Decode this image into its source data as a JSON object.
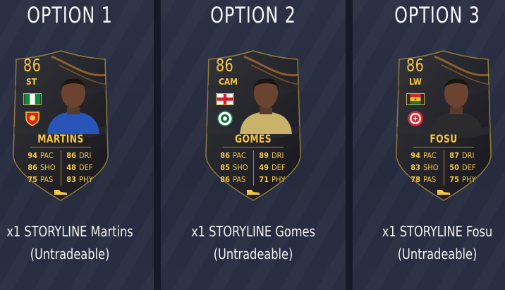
{
  "options": [
    {
      "title": "OPTION 1",
      "card": {
        "rating": "86",
        "position": "ST",
        "name": "MARTINS",
        "stats": [
          [
            "94",
            "PAC"
          ],
          [
            "86",
            "DRI"
          ],
          [
            "86",
            "SHO"
          ],
          [
            "48",
            "DEF"
          ],
          [
            "75",
            "PAS"
          ],
          [
            "83",
            "PHY"
          ]
        ],
        "flag": "nigeria-flag-icon",
        "club": "club-crest-icon",
        "kit_color": "#2a55b8"
      },
      "reward_line1": "x1 STORYLINE Martins",
      "reward_line2": "(Untradeable)"
    },
    {
      "title": "OPTION 2",
      "card": {
        "rating": "86",
        "position": "CAM",
        "name": "GOMES",
        "stats": [
          [
            "86",
            "PAC"
          ],
          [
            "89",
            "DRI"
          ],
          [
            "85",
            "SHO"
          ],
          [
            "49",
            "DEF"
          ],
          [
            "86",
            "PAS"
          ],
          [
            "71",
            "PHY"
          ]
        ],
        "flag": "england-flag-icon",
        "club": "club-crest-icon",
        "kit_color": "#c9b26a"
      },
      "reward_line1": "x1 STORYLINE Gomes",
      "reward_line2": "(Untradeable)"
    },
    {
      "title": "OPTION 3",
      "card": {
        "rating": "86",
        "position": "LW",
        "name": "FOSU",
        "stats": [
          [
            "94",
            "PAC"
          ],
          [
            "87",
            "DRI"
          ],
          [
            "83",
            "SHO"
          ],
          [
            "50",
            "DEF"
          ],
          [
            "78",
            "PAS"
          ],
          [
            "75",
            "PHY"
          ]
        ],
        "flag": "ghana-flag-icon",
        "club": "club-crest-icon",
        "kit_color": "#2b2b2e"
      },
      "reward_line1": "x1 STORYLINE Fosu",
      "reward_line2": "(Untradeable)"
    }
  ],
  "colors": {
    "gold": "#f5c542",
    "card_bg": "#1c1c22",
    "panel": "#2a2e43"
  }
}
